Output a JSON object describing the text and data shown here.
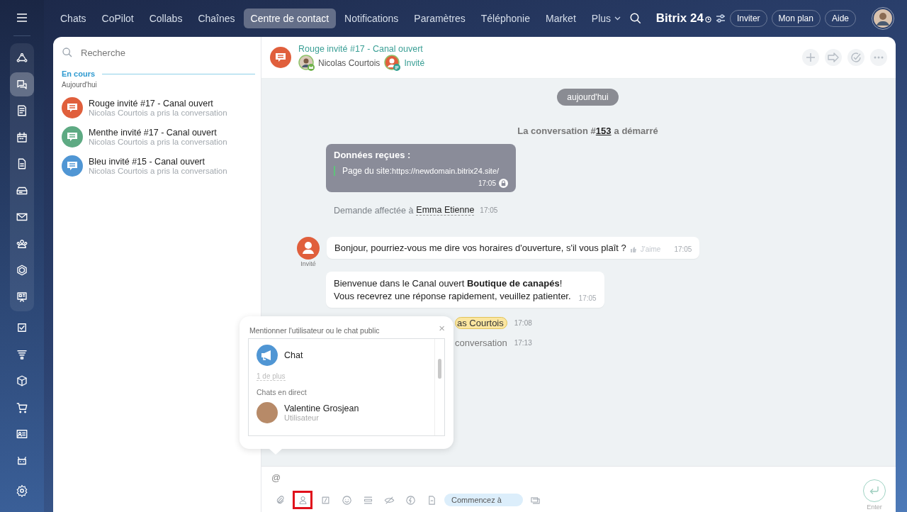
{
  "sidebar": {
    "pinned_items": [
      {
        "selected": false
      },
      {
        "selected": true
      },
      {
        "selected": false
      },
      {
        "selected": false
      },
      {
        "selected": false
      },
      {
        "selected": false
      },
      {
        "selected": false
      },
      {
        "selected": false
      },
      {
        "selected": false
      },
      {
        "selected": false
      }
    ],
    "items": [
      {
        "selected": false
      },
      {
        "selected": false
      },
      {
        "selected": false
      },
      {
        "selected": false
      },
      {
        "selected": false
      },
      {
        "selected": false
      }
    ]
  },
  "tabs": [
    {
      "label": "Chats",
      "selected": false
    },
    {
      "label": "CoPilot",
      "selected": false
    },
    {
      "label": "Collabs",
      "selected": false
    },
    {
      "label": "Chaînes",
      "selected": false
    },
    {
      "label": "Centre de contact",
      "selected": true
    },
    {
      "label": "Notifications",
      "selected": false
    },
    {
      "label": "Paramètres",
      "selected": false
    },
    {
      "label": "Téléphonie",
      "selected": false
    },
    {
      "label": "Market",
      "selected": false
    },
    {
      "label": "Plus",
      "selected": false
    }
  ],
  "header": {
    "logo": "Bitrix 24",
    "buttons": [
      "Inviter",
      "Mon plan",
      "Aide"
    ]
  },
  "recent": {
    "search": {
      "placeholder": "Recherche"
    },
    "section": "En cours",
    "date": "Aujourd'hui",
    "items": [
      {
        "title": "Rouge invité #17 - Canal ouvert",
        "subtitle": "Nicolas Courtois a pris la conversation",
        "color": "#e05f3c"
      },
      {
        "title": "Menthe invité #17 - Canal ouvert",
        "subtitle": "Nicolas Courtois a pris la conversation",
        "color": "#5eaa83"
      },
      {
        "title": "Bleu invité #15 - Canal ouvert",
        "subtitle": "Nicolas Courtois a pris la conversation",
        "color": "#5096d4"
      }
    ]
  },
  "chat": {
    "title": "Rouge invité #17 - Canal ouvert",
    "members": [
      {
        "name": "Nicolas Courtois",
        "kind": "operator"
      },
      {
        "name": "Invité",
        "kind": "guest"
      }
    ],
    "date": "aujourd'hui",
    "started": {
      "before": "La conversation #",
      "number": "153",
      "after": "a démarré"
    },
    "data_card": {
      "title": "Données reçues :",
      "label": "Page du site:",
      "url": "https://newdomain.bitrix24.site/",
      "time": "17:05"
    },
    "assigned": {
      "text": "Demande affectée à",
      "name": "Emma Etienne",
      "time": "17:05"
    },
    "guest_message": {
      "author": "Invité",
      "text": "Bonjour, pourriez-vous me dire vos horaires d'ouverture, s'il vous plaît ?",
      "like": "J'aime",
      "time": "17:05"
    },
    "bot_message": {
      "text": "Bienvenue dans le Canal ouvert **Boutique de canapés**!\nVous recevrez une réponse rapidement, veuillez patienter.",
      "time": "17:05"
    },
    "partial_lines": [
      {
        "mention": "as Courtois",
        "time": "17:08"
      },
      {
        "text": "conversation",
        "time": "17:13"
      }
    ]
  },
  "mention_popup": {
    "title": "Mentionner l'utilisateur ou le chat public",
    "close": "×",
    "chat": "Chat",
    "more": "1 de plus",
    "section": "Chats en direct",
    "user": {
      "name": "Valentine Grosjean",
      "role": "Utilisateur"
    }
  },
  "composer": {
    "value": "@",
    "tools": [
      {
        "kind": "icon",
        "highlighted": false
      },
      {
        "kind": "icon",
        "highlighted": true
      },
      {
        "kind": "icon",
        "highlighted": false
      },
      {
        "kind": "icon",
        "highlighted": false
      },
      {
        "kind": "icon",
        "highlighted": false
      },
      {
        "kind": "icon",
        "highlighted": false
      },
      {
        "kind": "icon",
        "highlighted": false
      },
      {
        "kind": "icon",
        "highlighted": false
      },
      {
        "kind": "pill",
        "label": "Commencez à",
        "highlighted": false
      },
      {
        "kind": "icon",
        "highlighted": false
      }
    ],
    "send_label": "Enter"
  }
}
